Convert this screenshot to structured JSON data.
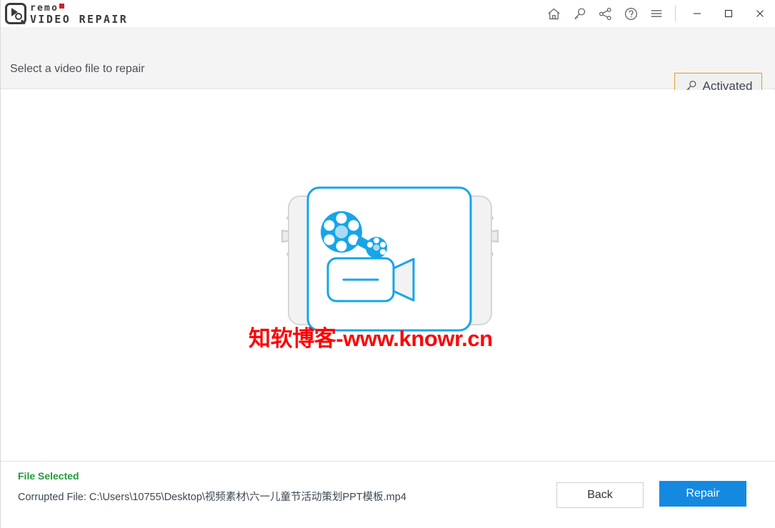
{
  "app": {
    "logo_primary": "remo",
    "logo_secondary": "VIDEO REPAIR"
  },
  "titlebar": {
    "icons": [
      {
        "name": "home-icon",
        "label": "Home"
      },
      {
        "name": "key-icon",
        "label": "Activate"
      },
      {
        "name": "share-icon",
        "label": "Share"
      },
      {
        "name": "help-icon",
        "label": "Help"
      },
      {
        "name": "menu-icon",
        "label": "Menu"
      }
    ],
    "window_controls": [
      {
        "name": "minimize-button",
        "label": "Minimize"
      },
      {
        "name": "maximize-button",
        "label": "Maximize"
      },
      {
        "name": "close-button",
        "label": "Close"
      }
    ]
  },
  "header": {
    "title": "Select a video file to repair",
    "activated_label": "Activated",
    "activated_border_color": "#e09a2b"
  },
  "illustration": {
    "watermark": "知软博客-www.knowr.cn",
    "watermark_color": "#fa0505",
    "accent_color": "#17a5e8",
    "gear_fill": "#ececec",
    "gear_stroke": "#cccccc",
    "panel_fill": "#f2f2f2"
  },
  "footer": {
    "status_label": "File Selected",
    "status_color": "#1f9b38",
    "file_path_line": "Corrupted File: C:\\Users\\10755\\Desktop\\视频素材\\六一儿童节活动策划PPT模板.mp4",
    "back_label": "Back",
    "repair_label": "Repair",
    "repair_color": "#1589e0"
  }
}
